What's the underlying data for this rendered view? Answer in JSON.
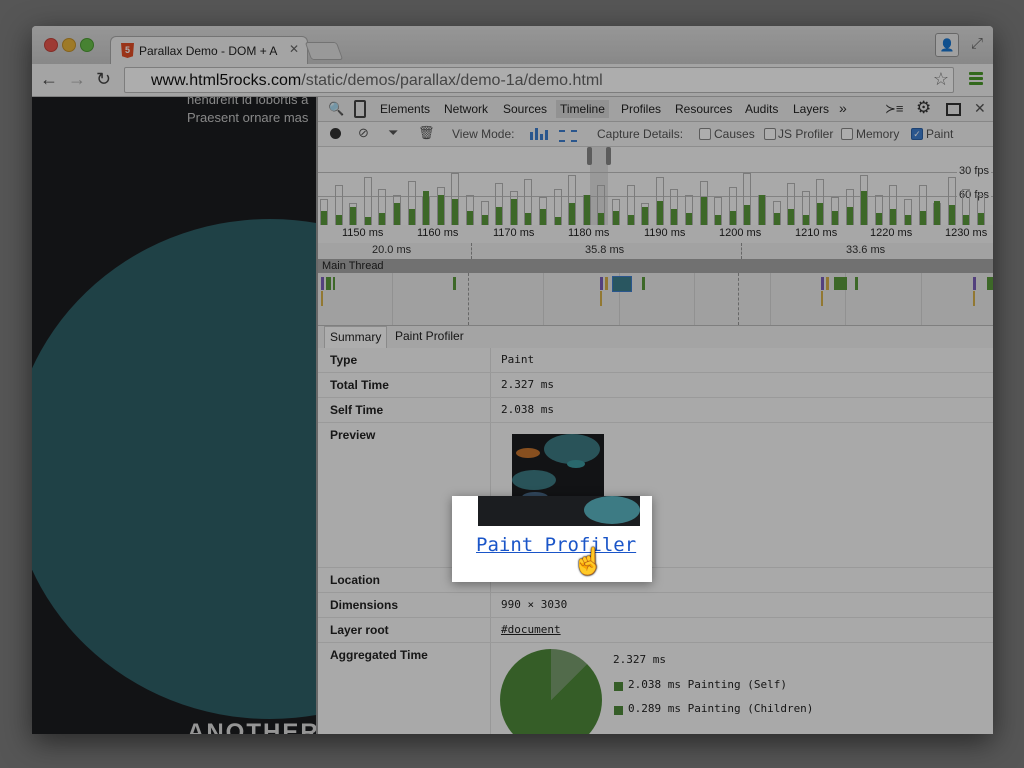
{
  "browser": {
    "tab_title": "Parallax Demo - DOM + A",
    "tab_icon": "html5-icon",
    "url_host": "www.html5rocks.com",
    "url_path": "/static/demos/parallax/demo-1a/demo.html"
  },
  "page": {
    "text_line1": "hendrerit id lobortis a",
    "text_line2": "Praesent ornare mas",
    "heading": "ANOTHER"
  },
  "devtools": {
    "tabs": [
      "Elements",
      "Network",
      "Sources",
      "Timeline",
      "Profiles",
      "Resources",
      "Audits",
      "Layers"
    ],
    "active_tab": "Timeline",
    "more": "»",
    "controls": {
      "view_mode_label": "View Mode:",
      "capture_label": "Capture Details:",
      "causes": "Causes",
      "js_profiler": "JS Profiler",
      "memory": "Memory",
      "paint": "Paint"
    },
    "fps": {
      "fps30": "30 fps",
      "fps60": "60 fps"
    },
    "ruler": [
      "1150 ms",
      "1160 ms",
      "1170 ms",
      "1180 ms",
      "1190 ms",
      "1200 ms",
      "1210 ms",
      "1220 ms",
      "1230 ms"
    ],
    "frames": [
      "20.0 ms",
      "35.8 ms",
      "33.6 ms"
    ],
    "main_thread": "Main Thread",
    "detail_tabs": [
      "Summary",
      "Paint Profiler"
    ],
    "summary": {
      "type_label": "Type",
      "type_value": "Paint",
      "total_label": "Total Time",
      "total_value": "2.327 ms",
      "self_label": "Self Time",
      "self_value": "2.038 ms",
      "preview_label": "Preview",
      "location_label": "Location",
      "dimensions_label": "Dimensions",
      "dimensions_value": "990 × 3030",
      "layer_root_label": "Layer root",
      "layer_root_value": "#document",
      "aggregated_label": "Aggregated Time",
      "agg_total": "2.327 ms",
      "agg_self": "2.038 ms Painting (Self)",
      "agg_children": "0.289 ms Painting (Children)"
    },
    "paint_profiler_link": "Paint Profiler"
  },
  "colors": {
    "painting": "#4e8a3a",
    "accent": "#3f7fd0",
    "link": "#1a55c8"
  }
}
